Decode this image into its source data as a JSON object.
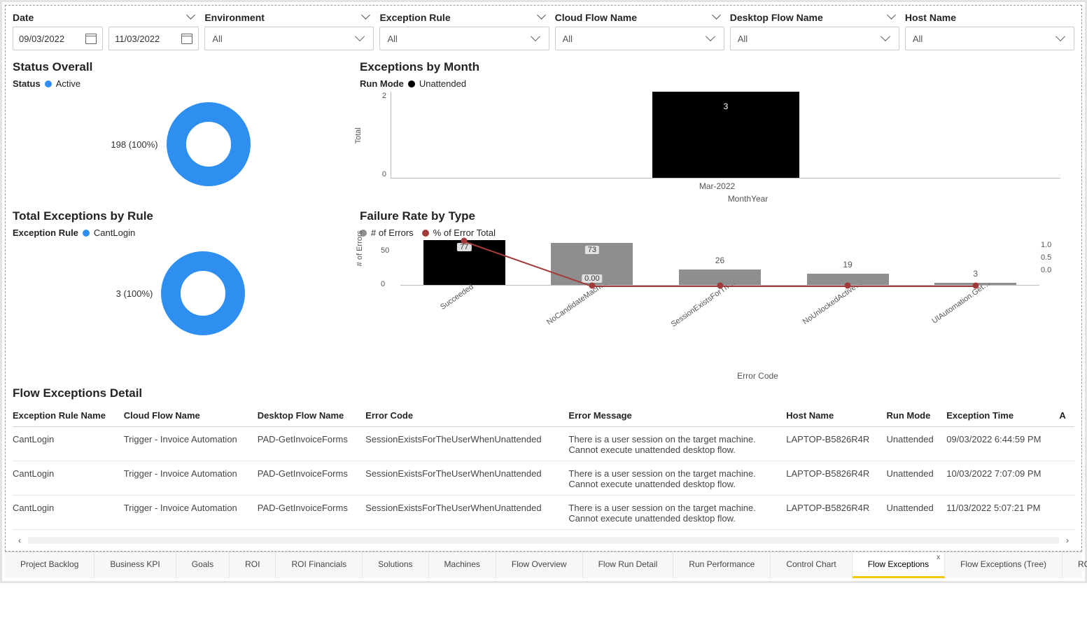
{
  "filters": {
    "date": {
      "label": "Date",
      "start": "09/03/2022",
      "end": "11/03/2022"
    },
    "environment": {
      "label": "Environment",
      "value": "All"
    },
    "exception_rule": {
      "label": "Exception Rule",
      "value": "All"
    },
    "cloud_flow_name": {
      "label": "Cloud Flow Name",
      "value": "All"
    },
    "desktop_flow_name": {
      "label": "Desktop Flow Name",
      "value": "All"
    },
    "host_name": {
      "label": "Host Name",
      "value": "All"
    }
  },
  "status_overall": {
    "title": "Status Overall",
    "legend_label": "Status",
    "series_name": "Active",
    "donut_label": "198 (100%)"
  },
  "exceptions_by_month": {
    "title": "Exceptions by Month",
    "legend_label": "Run Mode",
    "series_name": "Unattended",
    "y_axis_label": "Total",
    "x_axis_label": "MonthYear",
    "y_ticks": {
      "top": "2",
      "bottom": "0"
    },
    "category": "Mar-2022",
    "value": "3"
  },
  "total_exceptions": {
    "title": "Total Exceptions by Rule",
    "legend_label": "Exception Rule",
    "series_name": "CantLogin",
    "donut_label": "3 (100%)"
  },
  "failure_rate": {
    "title": "Failure Rate by Type",
    "legend1": "# of Errors",
    "legend2": "% of Error Total",
    "y_axis_label": "# of Errors",
    "x_axis_label": "Error Code",
    "y_ticks": {
      "t50": "50",
      "t0": "0"
    },
    "y2_ticks": {
      "t1": "1.0",
      "t05": "0.5",
      "t0": "0.0"
    },
    "overlay_label": "0.00",
    "bars": [
      {
        "label": "Succeeded",
        "value": "77",
        "h": 64,
        "cls": "bar-black",
        "inbar": true
      },
      {
        "label": "NoCandidateMach…",
        "value": "73",
        "h": 60,
        "cls": "bar-grey",
        "inbar": true
      },
      {
        "label": "SessionExistsForTh…",
        "value": "26",
        "h": 22,
        "cls": "bar-grey",
        "inbar": false
      },
      {
        "label": "NoUnlockedActive…",
        "value": "19",
        "h": 16,
        "cls": "bar-grey",
        "inbar": false
      },
      {
        "label": "UIAutomation.Get…",
        "value": "3",
        "h": 3,
        "cls": "bar-grey",
        "inbar": false
      }
    ]
  },
  "detail": {
    "title": "Flow Exceptions Detail",
    "headers": {
      "rule": "Exception Rule Name",
      "cloud": "Cloud Flow Name",
      "desktop": "Desktop Flow Name",
      "code": "Error Code",
      "msg": "Error Message",
      "host": "Host Name",
      "mode": "Run Mode",
      "time": "Exception Time",
      "a": "A"
    },
    "rows": [
      {
        "rule": "CantLogin",
        "cloud": "Trigger - Invoice Automation",
        "desktop": "PAD-GetInvoiceForms",
        "code": "SessionExistsForTheUserWhenUnattended",
        "msg": "There is a user session on the target machine. Cannot execute unattended desktop flow.",
        "host": "LAPTOP-B5826R4R",
        "mode": "Unattended",
        "time": "09/03/2022 6:44:59 PM"
      },
      {
        "rule": "CantLogin",
        "cloud": "Trigger - Invoice Automation",
        "desktop": "PAD-GetInvoiceForms",
        "code": "SessionExistsForTheUserWhenUnattended",
        "msg": "There is a user session on the target machine. Cannot execute unattended desktop flow.",
        "host": "LAPTOP-B5826R4R",
        "mode": "Unattended",
        "time": "10/03/2022 7:07:09 PM"
      },
      {
        "rule": "CantLogin",
        "cloud": "Trigger - Invoice Automation",
        "desktop": "PAD-GetInvoiceForms",
        "code": "SessionExistsForTheUserWhenUnattended",
        "msg": "There is a user session on the target machine. Cannot execute unattended desktop flow.",
        "host": "LAPTOP-B5826R4R",
        "mode": "Unattended",
        "time": "11/03/2022 5:07:21 PM"
      }
    ]
  },
  "tabs": [
    {
      "label": "Project Backlog",
      "active": false
    },
    {
      "label": "Business KPI",
      "active": false
    },
    {
      "label": "Goals",
      "active": false
    },
    {
      "label": "ROI",
      "active": false
    },
    {
      "label": "ROI Financials",
      "active": false
    },
    {
      "label": "Solutions",
      "active": false
    },
    {
      "label": "Machines",
      "active": false
    },
    {
      "label": "Flow Overview",
      "active": false
    },
    {
      "label": "Flow Run Detail",
      "active": false
    },
    {
      "label": "Run Performance",
      "active": false
    },
    {
      "label": "Control Chart",
      "active": false
    },
    {
      "label": "Flow Exceptions",
      "active": true
    },
    {
      "label": "Flow Exceptions (Tree)",
      "active": false
    },
    {
      "label": "ROI Calculations",
      "active": false
    }
  ],
  "chart_data": [
    {
      "type": "pie",
      "title": "Status Overall",
      "series": [
        {
          "name": "Active",
          "values": [
            198
          ]
        }
      ],
      "labels": [
        "Active"
      ],
      "annotation": "198 (100%)"
    },
    {
      "type": "bar",
      "title": "Exceptions by Month",
      "categories": [
        "Mar-2022"
      ],
      "series": [
        {
          "name": "Unattended",
          "values": [
            3
          ]
        }
      ],
      "xlabel": "MonthYear",
      "ylabel": "Total",
      "ylim": [
        0,
        3
      ]
    },
    {
      "type": "pie",
      "title": "Total Exceptions by Rule",
      "series": [
        {
          "name": "CantLogin",
          "values": [
            3
          ]
        }
      ],
      "labels": [
        "CantLogin"
      ],
      "annotation": "3 (100%)"
    },
    {
      "type": "bar",
      "title": "Failure Rate by Type",
      "categories": [
        "Succeeded",
        "NoCandidateMach…",
        "SessionExistsForTh…",
        "NoUnlockedActive…",
        "UIAutomation.Get…"
      ],
      "series": [
        {
          "name": "# of Errors",
          "values": [
            77,
            73,
            26,
            19,
            3
          ]
        },
        {
          "name": "% of Error Total",
          "values": [
            1.0,
            0.0,
            0.0,
            0.0,
            0.0
          ]
        }
      ],
      "xlabel": "Error Code",
      "ylabel": "# of Errors",
      "ylim": [
        0,
        80
      ],
      "y2lim": [
        0.0,
        1.0
      ]
    }
  ]
}
